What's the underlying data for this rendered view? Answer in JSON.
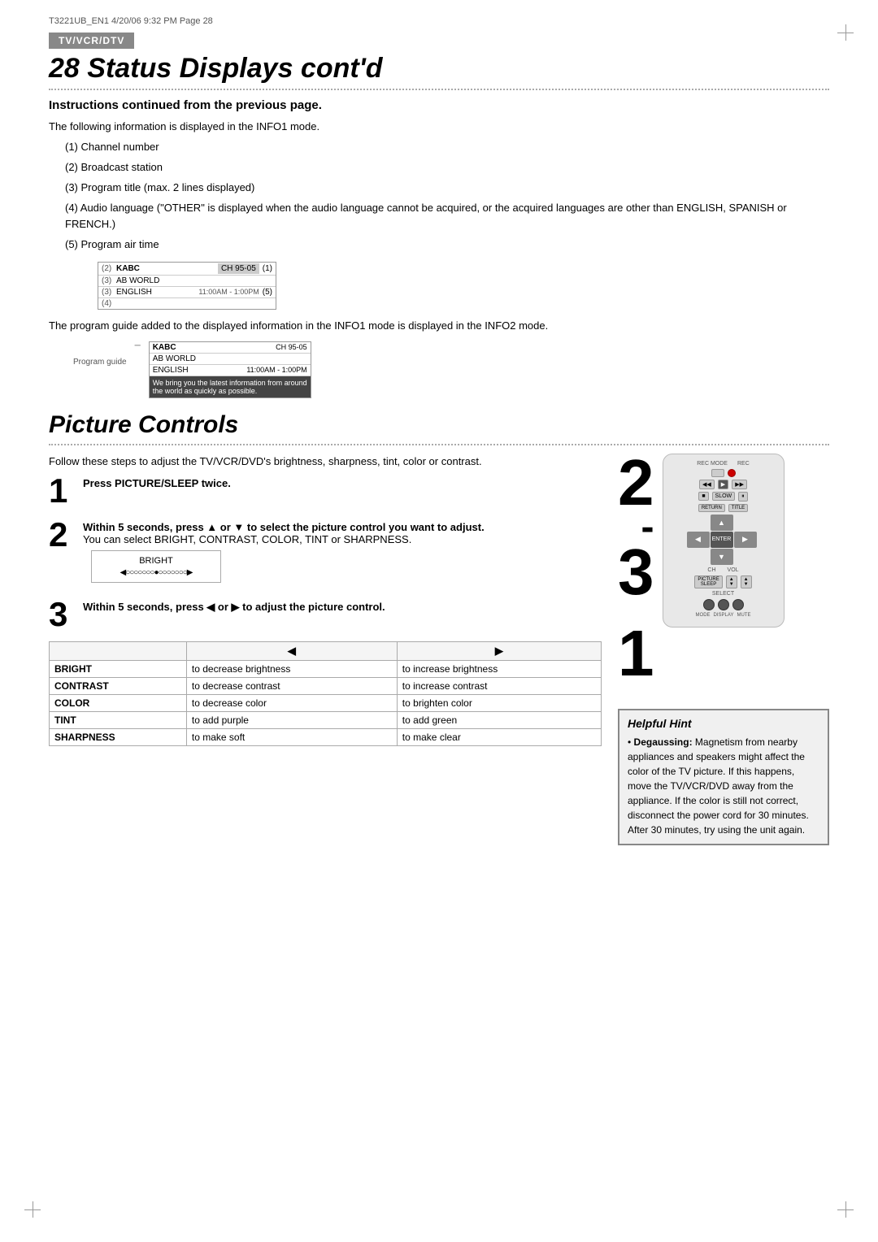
{
  "header": {
    "page_ref": "T3221UB_EN1  4/20/06  9:32 PM  Page 28"
  },
  "badge": {
    "label": "TV/VCR/DTV"
  },
  "section1": {
    "title": "28  Status Displays cont'd",
    "subtitle": "Instructions continued from the previous page.",
    "body_intro": "The following information is displayed in the INFO1 mode.",
    "items": [
      "(1) Channel number",
      "(2) Broadcast station",
      "(3) Program title (max. 2 lines displayed)",
      "(4) Audio language (\"OTHER\" is displayed when the audio language cannot be acquired, or the acquired languages are other than ENGLISH, SPANISH or FRENCH.)",
      "(5) Program air time"
    ],
    "info1_box": {
      "rows": [
        {
          "num": "(2)",
          "station": "KABC",
          "ch": "CH 95-05",
          "annot": "(1)"
        },
        {
          "num": "(3)",
          "station": "AB WORLD",
          "ch": "",
          "annot": ""
        },
        {
          "num": "(3)",
          "station": "ENGLISH",
          "ch": "11:00AM - 1:00PM",
          "annot": "(5)"
        },
        {
          "num": "(4)",
          "station": "",
          "ch": "",
          "annot": ""
        }
      ]
    },
    "body_info2": "The program guide added to the displayed information in the INFO1 mode is displayed in the INFO2 mode.",
    "info2_label": "Program guide",
    "info2_box": {
      "rows": [
        {
          "text": "KABC",
          "right": "CH 95-05"
        },
        {
          "text": "AB WORLD",
          "right": ""
        },
        {
          "text": "ENGLISH",
          "right": "11:00AM - 1:00PM"
        },
        {
          "text": "We bring you the latest information from around the world as quickly as possible.",
          "highlight": true
        }
      ]
    }
  },
  "section2": {
    "title": "Picture Controls",
    "intro": "Follow these steps to adjust the TV/VCR/DVD's brightness, sharpness, tint, color or contrast.",
    "step1": {
      "num": "1",
      "instruction_bold": "Press PICTURE/SLEEP twice."
    },
    "step2": {
      "num": "2",
      "instruction_bold": "Within 5 seconds, press ▲ or ▼ to select the picture control you want to adjust.",
      "instruction_normal": "You can select BRIGHT, CONTRAST, COLOR, TINT or SHARPNESS.",
      "bright_label": "BRIGHT",
      "bright_bar": "◀○○○○○○○●○○○○○○○▶"
    },
    "steps_23_display": "2-3",
    "step1_display": "1",
    "step3": {
      "num": "3",
      "instruction_bold": "Within 5 seconds, press ◀ or ▶ to adjust the picture control."
    },
    "table": {
      "headers": [
        "",
        "◀",
        "▶"
      ],
      "rows": [
        {
          "control": "BRIGHT",
          "left": "to decrease brightness",
          "right": "to increase brightness"
        },
        {
          "control": "CONTRAST",
          "left": "to decrease contrast",
          "right": "to increase contrast"
        },
        {
          "control": "COLOR",
          "left": "to decrease color",
          "right": "to brighten color"
        },
        {
          "control": "TINT",
          "left": "to add purple",
          "right": "to add green"
        },
        {
          "control": "SHARPNESS",
          "left": "to make soft",
          "right": "to make clear"
        }
      ]
    },
    "hint": {
      "title": "Helpful Hint",
      "bullet_bold": "Degaussing:",
      "bullet_text": " Magnetism from nearby appliances and speakers might affect the color of the TV picture. If this happens, move the TV/VCR/DVD away from the appliance. If the color is still not correct, disconnect the power cord for 30 minutes. After 30 minutes, try using the unit again."
    }
  }
}
